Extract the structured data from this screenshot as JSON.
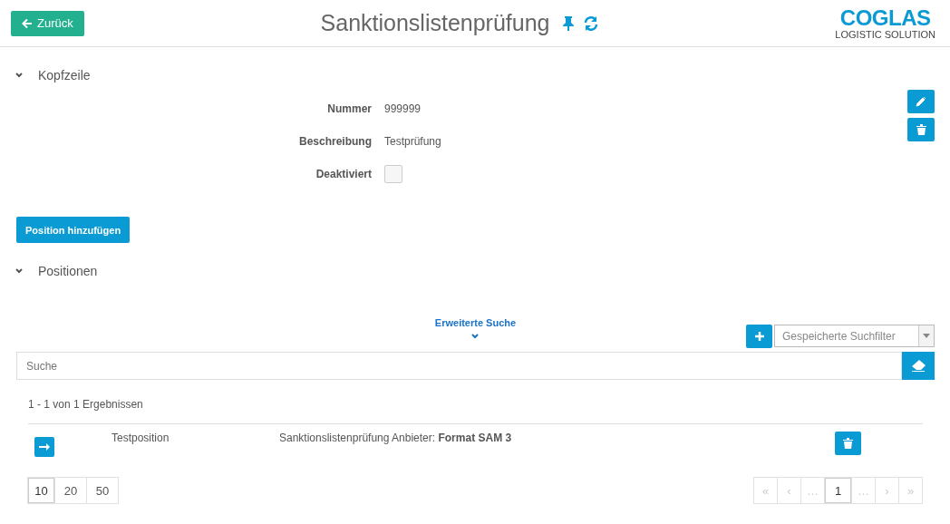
{
  "header": {
    "back_button": "Zurück",
    "title": "Sanktionslistenprüfung",
    "logo": {
      "name": "COGLAS",
      "tagline": "LOGISTIC SOLUTION"
    }
  },
  "kopfzeile": {
    "title": "Kopfzeile",
    "expanded": true,
    "fields": [
      {
        "kind": "text",
        "label": "Nummer",
        "value": "999999"
      },
      {
        "kind": "text",
        "label": "Beschreibung",
        "value": "Testprüfung"
      },
      {
        "kind": "checkbox",
        "label": "Deaktiviert",
        "checked": false
      }
    ]
  },
  "add_button": "Position hinzufügen",
  "positionen": {
    "title": "Positionen",
    "expanded": true,
    "advanced_search": "Erweiterte Suche",
    "saved_filter": {
      "placeholder": "Gespeicherte Suchfilter"
    },
    "search": {
      "placeholder": "Suche"
    },
    "result_count": "1 - 1 von 1 Ergebnissen",
    "rows": [
      {
        "name": "Testposition",
        "description": "Sanktionslistenprüfung Anbieter: **Format SAM 3**"
      }
    ],
    "page_sizes": [
      {
        "label": "10",
        "selected": true
      },
      {
        "label": "20",
        "selected": false
      },
      {
        "label": "50",
        "selected": false
      }
    ],
    "pagination": [
      {
        "label": "«",
        "disabled": true,
        "selected": false
      },
      {
        "label": "‹",
        "disabled": true,
        "selected": false
      },
      {
        "label": "…",
        "disabled": true,
        "selected": false
      },
      {
        "label": "1",
        "disabled": false,
        "selected": true
      },
      {
        "label": "…",
        "disabled": true,
        "selected": false
      },
      {
        "label": "›",
        "disabled": true,
        "selected": false
      },
      {
        "label": "»",
        "disabled": true,
        "selected": false
      }
    ]
  }
}
